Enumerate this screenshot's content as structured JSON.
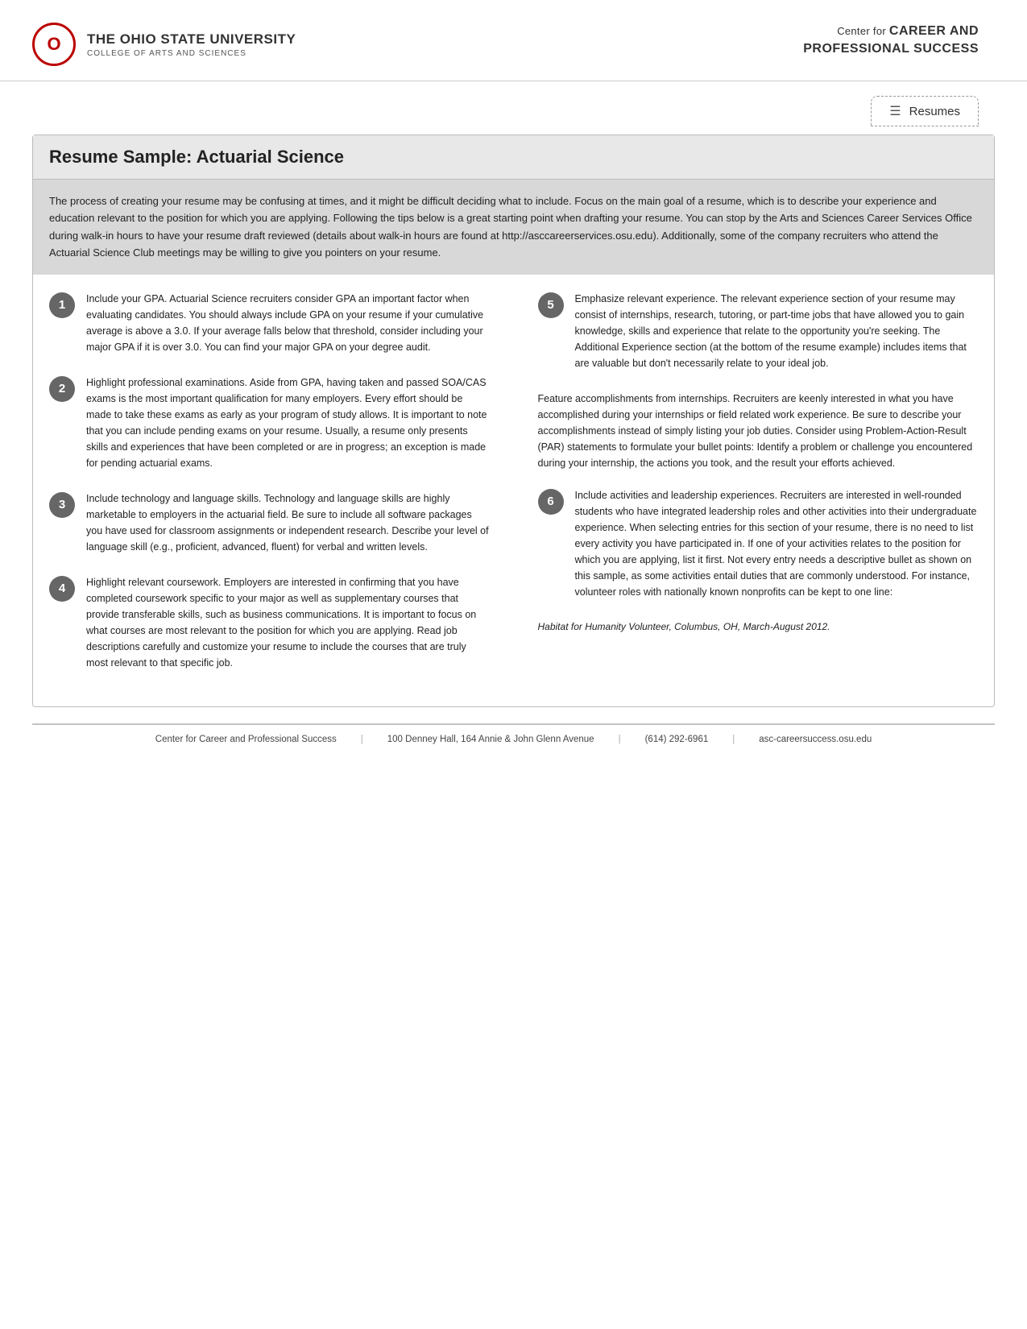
{
  "header": {
    "logo_letter": "O",
    "university_name": "The Ohio State University",
    "college_name": "College of Arts and Sciences",
    "center_label": "Center for",
    "career_bold": "Career and",
    "professional_bold": "Professional Success"
  },
  "resumes_tab": {
    "icon": "☰",
    "label": "Resumes"
  },
  "page_title": "Resume Sample: Actuarial Science",
  "intro_text": "The process of creating your resume may be confusing at times, and it might be difficult deciding what to include. Focus on the main goal of a resume, which is to describe your experience and education relevant to the position for which you are applying. Following the tips below is a great starting point when drafting your resume. You can stop by the Arts and Sciences Career Services Office during walk-in hours to have your resume draft reviewed (details about walk-in hours are found at http://asccareerservices.osu.edu). Additionally, some of the company recruiters who attend the Actuarial Science Club meetings may be willing to give you pointers on your resume.",
  "tips": [
    {
      "number": "1",
      "text": "Include your GPA. Actuarial Science recruiters consider GPA an important factor when evaluating candidates. You should always include GPA on your resume if your cumulative average is above a 3.0. If your average falls below that threshold, consider including your major GPA if it is over 3.0. You can find your major GPA on your degree audit."
    },
    {
      "number": "2",
      "text": "Highlight professional examinations. Aside from GPA, having taken and passed SOA/CAS exams is the most important qualification for many employers. Every effort should be made to take these exams as early as your program of study allows. It is important to note that you can include pending exams on your resume. Usually, a resume only presents skills and experiences that have been completed or are in progress; an exception is made for pending actuarial exams."
    },
    {
      "number": "3",
      "text": "Include technology and language skills. Technology and language skills are highly marketable to employers in the actuarial field. Be sure to include all software packages you have used for classroom assignments or independent research. Describe your level of language skill (e.g., proficient, advanced, fluent) for verbal and written levels."
    },
    {
      "number": "4",
      "text": "Highlight relevant coursework. Employers are interested in confirming that you have completed coursework specific to your major as well as supplementary courses that provide transferable skills, such as business communications. It is important to focus on what courses are most relevant to the position for which you are applying. Read job descriptions carefully and customize your resume to include the courses that are truly most relevant to that specific job."
    }
  ],
  "right_tips": [
    {
      "number": "5",
      "text": "Emphasize relevant experience. The relevant experience section of your resume may consist of internships, research, tutoring, or part-time jobs that have allowed you to gain knowledge, skills and experience that relate to the opportunity you're seeking. The Additional Experience section (at the bottom of the resume example) includes items that are valuable but don't necessarily relate to your ideal job."
    },
    {
      "number": null,
      "text": "Feature accomplishments from internships. Recruiters are keenly interested in what you have accomplished during your internships or field related work experience. Be sure to describe your accomplishments instead of simply listing your job duties. Consider using Problem-Action-Result (PAR) statements to formulate your bullet points: Identify a problem or challenge you encountered during your internship, the actions you took, and the result your efforts achieved."
    },
    {
      "number": "6",
      "text": "Include activities and leadership experiences. Recruiters are interested in well-rounded students who have integrated leadership roles and other activities into their undergraduate experience. When selecting entries for this section of your resume, there is no need to list every activity you have participated in. If one of your activities relates to the position for which you are applying, list it first. Not every entry needs a descriptive bullet as shown on this sample, as some activities entail duties that are commonly understood. For instance, volunteer roles with nationally known nonprofits can be kept to one line:"
    },
    {
      "number": null,
      "text": "Habitat for Humanity Volunteer, Columbus, OH, March-August 2012.",
      "italic": true
    }
  ],
  "footer": {
    "center": "Center for Career and Professional Success",
    "address": "100 Denney Hall, 164 Annie & John Glenn  Avenue",
    "phone": "(614) 292-6961",
    "website": "asc-careersuccess.osu.edu"
  }
}
